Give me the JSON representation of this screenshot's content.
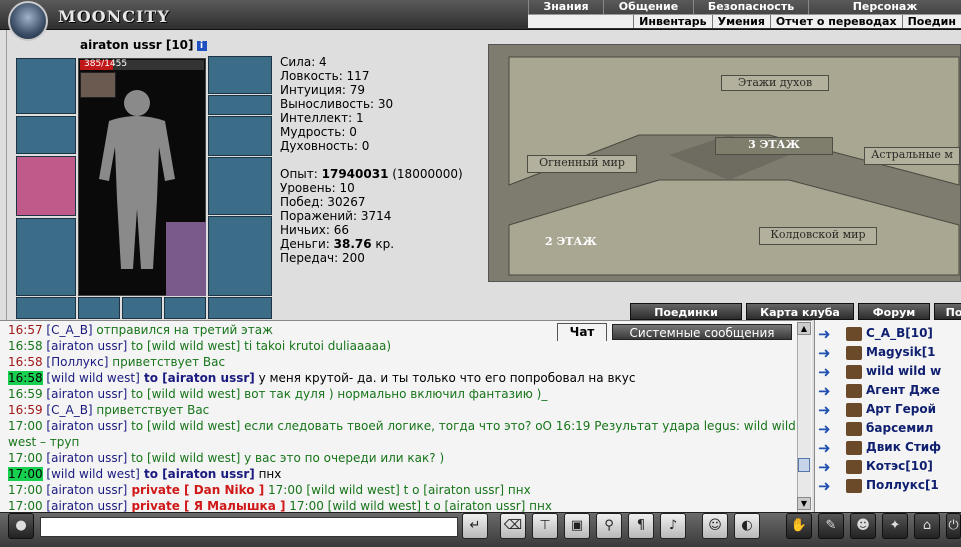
{
  "app": {
    "title": "MOONCITY"
  },
  "nav_main": [
    "Знания",
    "Общение",
    "Безопасность",
    "Персонаж"
  ],
  "nav_sub": [
    "Инвентарь",
    "Умения",
    "Отчет о переводах",
    "Поедин"
  ],
  "character": {
    "name": "airaton ussr [10]",
    "info_label": "i",
    "hp_text": "385/1455",
    "hp_fraction": 0.265
  },
  "stats": {
    "strength": "Сила: 4",
    "agility": "Ловкость: 117",
    "intuition": "Интуиция: 79",
    "endurance": "Выносливость: 30",
    "intellect": "Интеллект: 1",
    "wisdom": "Мудрость: 0",
    "spirituality": "Духовность: 0",
    "exp_label": "Опыт: ",
    "exp_value": "17940031",
    "exp_next": " (18000000)",
    "level": "Уровень: 10",
    "wins": "Побед: 30267",
    "losses": "Поражений: 3714",
    "draws": "Ничьих: 66",
    "money_label": "Деньги: ",
    "money_value": "38.76",
    "money_unit": " кр.",
    "transfers": "Передач: 200"
  },
  "map": {
    "spirit_floors": "Этажи духов",
    "floor3": "3 ЭТАЖ",
    "fire_world": "Огненный мир",
    "astral_worlds": "Астральные м",
    "sorcery_world": "Колдовской мир",
    "floor2": "2 ЭТАЖ"
  },
  "tabs": [
    "Поединки",
    "Карта клуба",
    "Форум",
    "По"
  ],
  "chat_tabs": {
    "chat": "Чат",
    "system": "Системные сообщения"
  },
  "chat": [
    {
      "time": "16:57",
      "nick": "[C_A_B]",
      "text": " отправился на третий этаж",
      "kind": "sys"
    },
    {
      "time": "16:58",
      "nick": "[airaton ussr]",
      "to": " to [wild wild west]",
      "text": " ti takoi krutoi duliaaaaa)",
      "kind": "msg"
    },
    {
      "time": "16:58",
      "nick": "[Поллукс]",
      "text": " приветствует Вас",
      "kind": "sys"
    },
    {
      "time": "16:58",
      "nick": "[wild wild west]",
      "to": " to [airaton ussr]",
      "text": " у меня крутой- да. и ты только что его попробовал на вкус",
      "kind": "hl"
    },
    {
      "time": "16:59",
      "nick": "[airaton ussr]",
      "to": " to [wild wild west]",
      "text": " вот так дуля ) нормально включил фантазию )_",
      "kind": "msg"
    },
    {
      "time": "16:59",
      "nick": "[C_A_B]",
      "text": " приветствует Вас",
      "kind": "sys"
    },
    {
      "time": "17:00",
      "nick": "[airaton ussr]",
      "to": " to [wild wild west]",
      "text": " если следовать твоей логике, тогда что это? оО 16:19 Результат удара legus: wild wild west – труп",
      "kind": "msgwrap"
    },
    {
      "time": "17:00",
      "nick": "[airaton ussr]",
      "to": " to [wild wild west]",
      "text": " у вас это по очереди или как? )",
      "kind": "msg"
    },
    {
      "time": "17:00",
      "nick": "[wild wild west]",
      "to": " to [airaton ussr]",
      "text": " пнх",
      "kind": "hl"
    },
    {
      "time": "17:00",
      "nick": "[airaton ussr]",
      "private": " private [ Dan Niko ]",
      "text": " 17:00 [wild wild west] t o [airaton ussr] пнх",
      "kind": "prv"
    },
    {
      "time": "17:00",
      "nick": "[airaton ussr]",
      "private": " private [ Я Малышка ]",
      "text": " 17:00 [wild wild west] t o [airaton ussr] пнх",
      "kind": "prv"
    }
  ],
  "users": [
    {
      "name": "C_A_B[10]"
    },
    {
      "name": "Magysik[1"
    },
    {
      "name": "wild wild w"
    },
    {
      "name": "Агент Дже"
    },
    {
      "name": "Арт Герой"
    },
    {
      "name": "барсемил"
    },
    {
      "name": "Двик Стиф"
    },
    {
      "name": "Котэс[10]"
    },
    {
      "name": "Поллукс[1"
    }
  ],
  "colors": {
    "accent": "#18d050",
    "private": "#d01818",
    "message": "#17751a"
  }
}
